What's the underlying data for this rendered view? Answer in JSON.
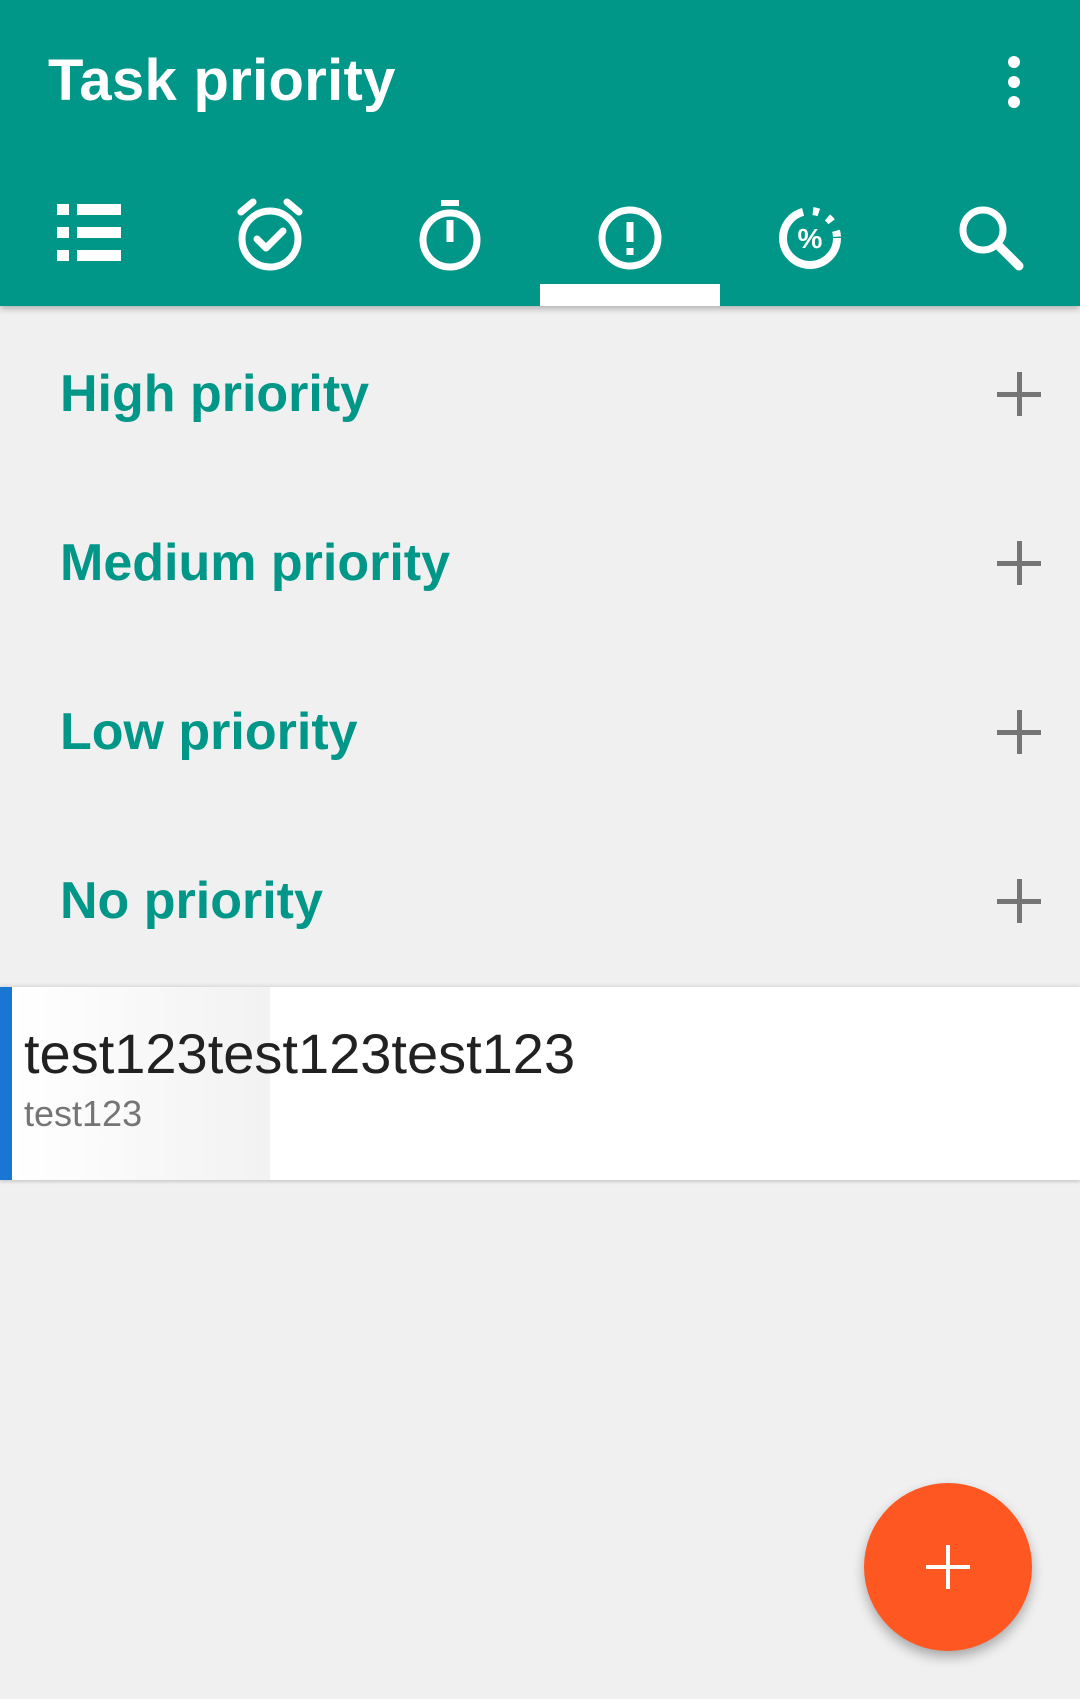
{
  "app_bar": {
    "title": "Task priority",
    "background_color": "#009688",
    "overflow_icon": "more-vert-icon"
  },
  "tabs": [
    {
      "icon": "list-icon",
      "selected": false
    },
    {
      "icon": "alarm-check-icon",
      "selected": false
    },
    {
      "icon": "timer-icon",
      "selected": false
    },
    {
      "icon": "priority-alert-icon",
      "selected": true
    },
    {
      "icon": "progress-percent-icon",
      "selected": false
    },
    {
      "icon": "search-icon",
      "selected": false
    }
  ],
  "priority_groups": [
    {
      "label": "High priority",
      "add_icon": "plus-icon"
    },
    {
      "label": "Medium priority",
      "add_icon": "plus-icon"
    },
    {
      "label": "Low priority",
      "add_icon": "plus-icon"
    },
    {
      "label": "No priority",
      "add_icon": "plus-icon"
    }
  ],
  "tasks": [
    {
      "title": "test123test123test123",
      "subtitle": "test123",
      "accent_color": "#1976d2"
    }
  ],
  "fab": {
    "icon": "plus-icon",
    "color": "#ff5722"
  },
  "colors": {
    "accent": "#009688",
    "background": "#f0f0f0",
    "icon_gray": "#757575"
  }
}
